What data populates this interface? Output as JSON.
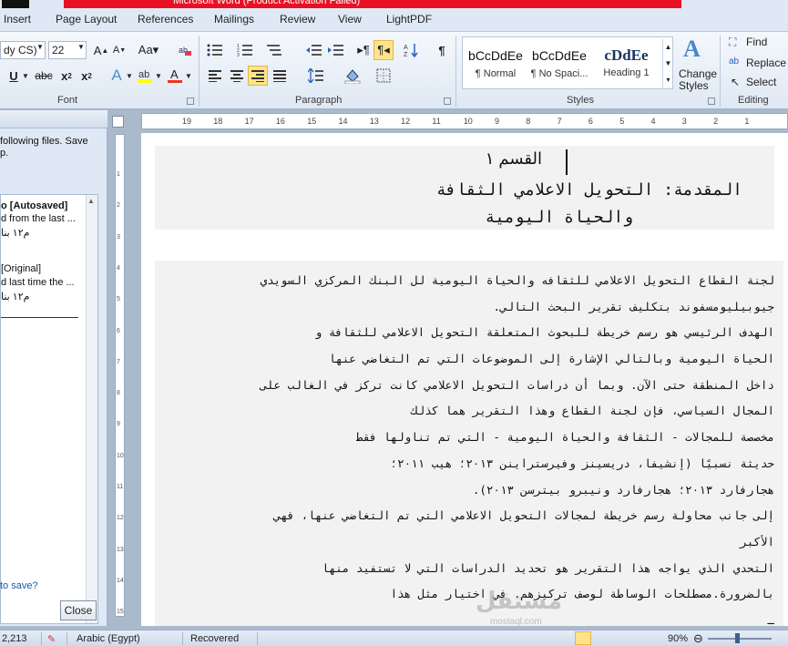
{
  "window": {
    "title": "Microsoft Word (Product Activation Failed)"
  },
  "tabs": [
    {
      "label": "Insert"
    },
    {
      "label": "Page Layout"
    },
    {
      "label": "References"
    },
    {
      "label": "Mailings"
    },
    {
      "label": "Review"
    },
    {
      "label": "View"
    },
    {
      "label": "LightPDF"
    }
  ],
  "ribbon": {
    "font": {
      "name": "dy CS)",
      "size": "22",
      "group_label": "Font"
    },
    "paragraph": {
      "group_label": "Paragraph"
    },
    "styles": {
      "group_label": "Styles",
      "cards": [
        {
          "sample": "bCcDdEe",
          "name": "¶ Normal"
        },
        {
          "sample": "bCcDdEe",
          "name": "¶ No Spaci..."
        },
        {
          "sample": "cDdEe",
          "name": "Heading 1"
        }
      ],
      "change_styles": "Change Styles"
    },
    "editing": {
      "group_label": "Editing",
      "find": "Find",
      "replace": "Replace",
      "select": "Select"
    }
  },
  "recovery_pane": {
    "message_lines": [
      "following files.  Save",
      "p."
    ],
    "records": [
      {
        "title": "o  [Autosaved]",
        "line1": "d from the last ...",
        "date": "م١٢ بنا"
      },
      {
        "title": "[Original]",
        "line1": "d last time the ...",
        "date": "م١٢ بنا"
      }
    ],
    "link": "to save?",
    "close_label": "Close"
  },
  "ruler": {
    "h_ticks": [
      "19",
      "18",
      "17",
      "16",
      "15",
      "14",
      "13",
      "12",
      "11",
      "10",
      "9",
      "8",
      "7",
      "6",
      "5",
      "4",
      "3",
      "2",
      "1"
    ],
    "v_ticks": [
      "1",
      "2",
      "3",
      "4",
      "5",
      "6",
      "7",
      "8",
      "9",
      "10",
      "11",
      "12",
      "13",
      "14",
      "15"
    ]
  },
  "document": {
    "section_title": "القسم ١",
    "heading_lines": [
      "المقدمة: التحويل الاعلامي الثقافة",
      "والحياة اليومية"
    ],
    "body_lines": [
      "لجنة القطاع التحويل الاعلامي للثقافه والحياة اليومية لل البنك المركزي السويدي",
      "جيوبيليومسفوند بتكليف تقرير البحث التالي.",
      "الهدف الرئيسي هو رسم خريطة للبحوث المتعلقة التحويل الاعلامي للثقافة و",
      "الحياة اليومية وبالتالي الإشارة إلى الموضوعات التي تم التغاضي عنها",
      "داخل المنطقة حتى الآن. وبما أن دراسات التحويل الاعلامي كانت تركز في الغالب على",
      "المجال السياسي، فإن لجنة القطاع وهذا التقرير هما كذلك",
      "مخصصة للمجالات - الثقافة والحياة اليومية - التي تم تناولها فقط",
      "حديثة نسبيًا (إنشيفا، دريسينز وفيرستراينن ٢٠١٣؛ هيب ٢٠١١؛",
      "هجارفارد ٢٠١٣؛ هجارفارد ونيبرو بيترسن ٢٠١٣).",
      "إلى جانب محاولة رسم خريطة لمجالات التحويل الاعلامي التي تم التغاضي عنها، فهي",
      "الأكبر",
      "التحدي الذي يواجه هذا التقرير هو تحديد الدراسات التي لا تستفيد منها",
      "بالضرورة.مصطلحات الوساطة لوصف تركيزهم. في اختيار مثل هذا",
      "ـ"
    ],
    "watermark": "مستقل",
    "watermark_sub": "mostaql.com"
  },
  "status_bar": {
    "words": "2,213",
    "language": "Arabic (Egypt)",
    "recovered": "Recovered",
    "zoom": "90%"
  },
  "colors": {
    "accent": "#2b579a",
    "highlight": "#ffe38a",
    "title_red": "#e81123",
    "heading_blue": "#17365d"
  }
}
